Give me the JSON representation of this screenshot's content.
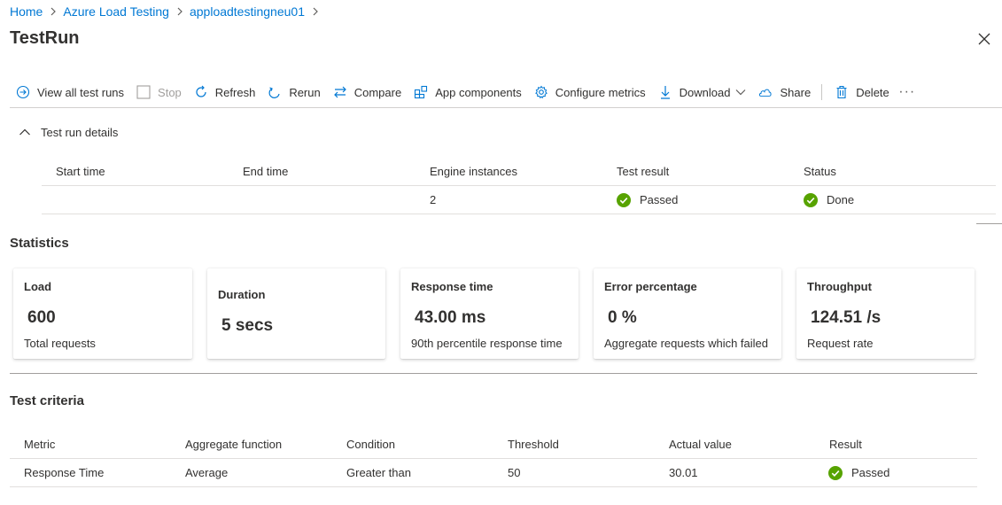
{
  "breadcrumb": {
    "home": "Home",
    "service": "Azure Load Testing",
    "resource": "apploadtestingneu01"
  },
  "page_title": "TestRun",
  "toolbar": {
    "view_all": "View all test runs",
    "stop": "Stop",
    "refresh": "Refresh",
    "rerun": "Rerun",
    "compare": "Compare",
    "app_components": "App components",
    "configure_metrics": "Configure metrics",
    "download": "Download",
    "share": "Share",
    "delete": "Delete",
    "more": "···"
  },
  "details": {
    "toggle_label": "Test run details",
    "headers": [
      "Start time",
      "End time",
      "Engine instances",
      "Test result",
      "Status"
    ],
    "row": {
      "start_time": "",
      "end_time": "",
      "engine_instances": "2",
      "test_result": "Passed",
      "status": "Done"
    }
  },
  "statistics": {
    "title": "Statistics",
    "cards": [
      {
        "title": "Load",
        "value": "600",
        "subtitle": "Total requests"
      },
      {
        "title": "Duration",
        "value": "5 secs",
        "subtitle": ""
      },
      {
        "title": "Response time",
        "value": "43.00 ms",
        "subtitle": "90th percentile response time"
      },
      {
        "title": "Error percentage",
        "value": "0 %",
        "subtitle": "Aggregate requests which failed"
      },
      {
        "title": "Throughput",
        "value": "124.51 /s",
        "subtitle": "Request rate"
      }
    ]
  },
  "criteria": {
    "title": "Test criteria",
    "headers": [
      "Metric",
      "Aggregate function",
      "Condition",
      "Threshold",
      "Actual value",
      "Result"
    ],
    "row": {
      "metric": "Response Time",
      "aggregate": "Average",
      "condition": "Greater than",
      "threshold": "50",
      "actual": "30.01",
      "result": "Passed"
    }
  },
  "colors": {
    "accent": "#0078d4",
    "success": "#57a300",
    "text": "#323130",
    "disabled": "#a19f9d"
  }
}
